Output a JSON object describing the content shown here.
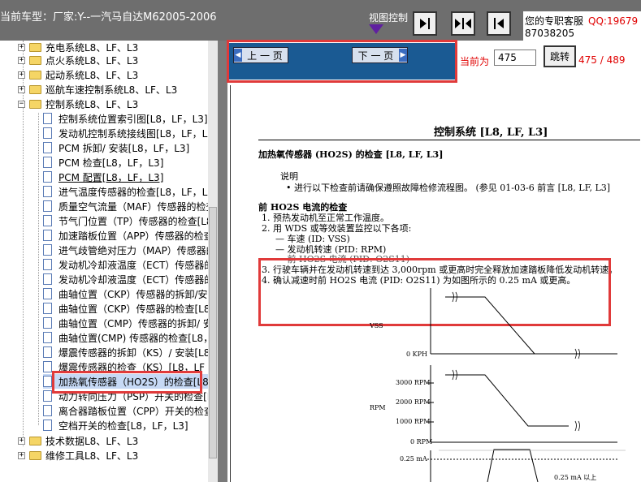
{
  "window": {
    "title": "当前车型：厂家:Y--一汽马自达M62005-2006"
  },
  "view_control": {
    "label": "视图控制"
  },
  "customer_service": {
    "label": "您的专职客服",
    "qq": "QQ:19679",
    "number": "87038205"
  },
  "tree": {
    "items": [
      {
        "label": "充电系统L8、LF、L3",
        "type": "folder",
        "expanded": false
      },
      {
        "label": "点火系统L8、LF、L3",
        "type": "folder",
        "expanded": false
      },
      {
        "label": "起动系统L8、LF、L3",
        "type": "folder",
        "expanded": false
      },
      {
        "label": "巡航车速控制系统L8、LF、L3",
        "type": "folder",
        "expanded": false
      },
      {
        "label": "控制系统L8、LF、L3",
        "type": "folder",
        "expanded": true
      },
      {
        "label": "控制系统位置索引图[L8，LF，L3]",
        "type": "doc"
      },
      {
        "label": "发动机控制系统接线图[L8，LF，L3]",
        "type": "doc"
      },
      {
        "label": "PCM 拆卸/ 安装[L8，LF，L3]",
        "type": "doc"
      },
      {
        "label": "PCM 检查[L8，LF，L3]",
        "type": "doc"
      },
      {
        "label": "PCM 配置[L8，LF，L3]",
        "type": "doc"
      },
      {
        "label": "进气温度传感器的检查[L8，LF，L3]",
        "type": "doc"
      },
      {
        "label": "质量空气流量（MAF）传感器的检查[L",
        "type": "doc"
      },
      {
        "label": "节气门位置（TP）传感器的检查[L8，",
        "type": "doc"
      },
      {
        "label": "加速踏板位置（APP）传感器的检查[L",
        "type": "doc"
      },
      {
        "label": "进气歧管绝对压力（MAP）传感器的",
        "type": "doc"
      },
      {
        "label": "发动机冷却液温度（ECT）传感器的",
        "type": "doc"
      },
      {
        "label": "发动机冷却液温度（ECT）传感器的",
        "type": "doc"
      },
      {
        "label": "曲轴位置（CKP）传感器的拆卸/安装",
        "type": "doc"
      },
      {
        "label": "曲轴位置（CKP）传感器的检查[L8，",
        "type": "doc"
      },
      {
        "label": "曲轴位置（CMP）传感器的拆卸/ 安",
        "type": "doc"
      },
      {
        "label": "曲轴位置(CMP) 传感器的检查[L8，",
        "type": "doc"
      },
      {
        "label": "爆震传感器的拆卸（KS）/ 安装[L8，",
        "type": "doc"
      },
      {
        "label": "爆震传感器的检查（KS）[L8，LF",
        "type": "doc"
      },
      {
        "label": "加热氧传感器（HO2S）的检查[L8，",
        "type": "doc",
        "selected": true
      },
      {
        "label": "动力转向压力（PSP）开关的检查[L8",
        "type": "doc"
      },
      {
        "label": "离合器踏板位置（CPP）开关的检查[",
        "type": "doc"
      },
      {
        "label": "空档开关的检查[L8，LF，L3]",
        "type": "doc"
      },
      {
        "label": "技术数据L8、LF、L3",
        "type": "folder",
        "expanded": false
      },
      {
        "label": "维修工具L8、LF、L3",
        "type": "folder",
        "expanded": false
      }
    ]
  },
  "pager": {
    "prev_label": "上 一 页",
    "next_label": "下 一 页",
    "current_label": "当前为",
    "current_page": "475",
    "go_label": "跳转",
    "page_count": "475 / 489"
  },
  "document": {
    "heading": "控制系统 [L8, LF, L3]",
    "subheading": "加热氧传感器 (HO2S) 的检查 [L8, LF, L3]",
    "note_title": "说明",
    "note_text": "• 进行以下检查前请确保遵照故障检修流程图。 (参见 01-03-6 前言 [L8, LF, L3]",
    "section_title": "前 HO2S 电流的检查",
    "steps": [
      "1. 预热发动机至正常工作温度。",
      "2. 用 WDS 或等效装置监控以下各项:",
      "— 车速 (ID: VSS)",
      "— 发动机转速 (PID: RPM)",
      "— 前 HO2S 电流 (PID: O2S11)",
      "3. 行驶车辆并在发动机转速到达 3,000rpm 或更高时完全释放加速踏板降低发动机转速。",
      "4. 确认减速时前 HO2S 电流 (PID: O2S11) 为如图所示的 0.25 mA 或更高。"
    ],
    "graph": {
      "vss_label": "VSS",
      "vss_zero": "0 KPH",
      "rpm_label": "RPM",
      "rpm_ticks": [
        "3000 RPM",
        "2000 RPM",
        "1000 RPM",
        "0 RPM"
      ],
      "ma_tick": "0.25 mA",
      "ma_note": "0.25 mA 以上"
    }
  }
}
